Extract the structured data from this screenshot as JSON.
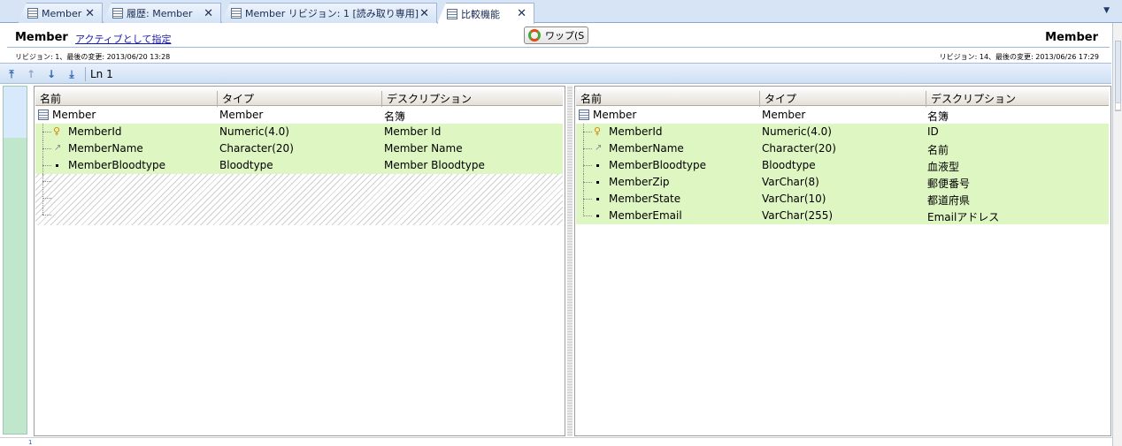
{
  "tabs": [
    {
      "label": "Member",
      "icon": "table-icon"
    },
    {
      "label": "履歴: Member",
      "icon": "table-icon"
    },
    {
      "label": "Member リビジョン: 1 [読み取り専用]",
      "icon": "table-icon"
    },
    {
      "label": "比較機能",
      "icon": "table-icon",
      "active": true
    }
  ],
  "header": {
    "left_title": "Member",
    "set_active_link": "アクティブとして指定",
    "swap_label": "ワップ(S",
    "right_title": "Member",
    "left_revision": "リビジョン: 1、最後の変更: 2013/06/20 13:28",
    "right_revision": "リビジョン: 14、最後の変更: 2013/06/26 17:29"
  },
  "toolbar": {
    "line_label": "Ln 1"
  },
  "columns": [
    "名前",
    "タイプ",
    "デスクリプション"
  ],
  "left": {
    "root": {
      "name": "Member",
      "type": "Member",
      "desc": "名簿"
    },
    "rows": [
      {
        "name": "MemberId",
        "type": "Numeric(4.0)",
        "desc": "Member Id",
        "icon": "key-icon"
      },
      {
        "name": "MemberName",
        "type": "Character(20)",
        "desc": "Member Name",
        "icon": "attribute-icon"
      },
      {
        "name": "MemberBloodtype",
        "type": "Bloodtype",
        "desc": "Member Bloodtype",
        "icon": "bullet-icon"
      }
    ]
  },
  "right": {
    "root": {
      "name": "Member",
      "type": "Member",
      "desc": "名簿"
    },
    "rows": [
      {
        "name": "MemberId",
        "type": "Numeric(4.0)",
        "desc": "ID",
        "icon": "key-icon"
      },
      {
        "name": "MemberName",
        "type": "Character(20)",
        "desc": "名前",
        "icon": "attribute-icon"
      },
      {
        "name": "MemberBloodtype",
        "type": "Bloodtype",
        "desc": "血液型",
        "icon": "bullet-icon"
      },
      {
        "name": "MemberZip",
        "type": "VarChar(8)",
        "desc": "郵便番号",
        "icon": "bullet-icon"
      },
      {
        "name": "MemberState",
        "type": "VarChar(10)",
        "desc": "都道府県",
        "icon": "bullet-icon"
      },
      {
        "name": "MemberEmail",
        "type": "VarChar(255)",
        "desc": "Emailアドレス",
        "icon": "bullet-icon"
      }
    ]
  },
  "status": {
    "bottom_marker": "1"
  },
  "colors": {
    "diff_row": "#def6c2",
    "gutter": "#c0e6cc",
    "tab_bar": "#d6e4f5"
  }
}
